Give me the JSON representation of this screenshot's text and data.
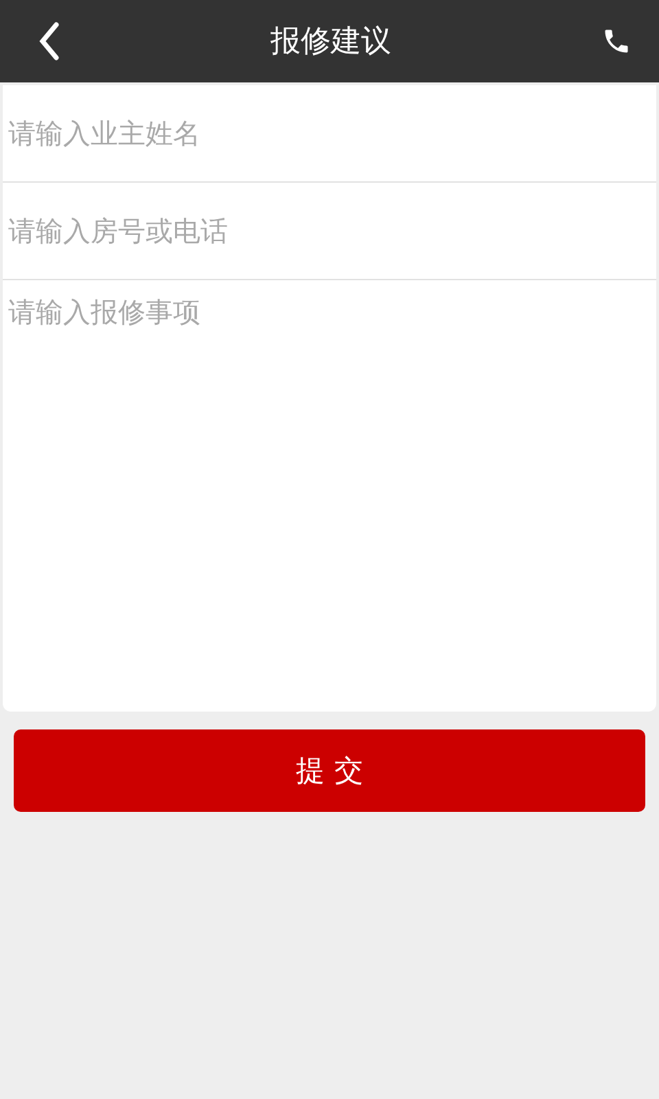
{
  "header": {
    "title": "报修建议"
  },
  "form": {
    "fields": [
      {
        "kind": "input",
        "placeholder": "请输入业主姓名"
      },
      {
        "kind": "input",
        "placeholder": "请输入房号或电话"
      },
      {
        "kind": "textarea",
        "placeholder": "请输入报修事项"
      }
    ]
  },
  "submit_button": {
    "label": "提 交"
  }
}
